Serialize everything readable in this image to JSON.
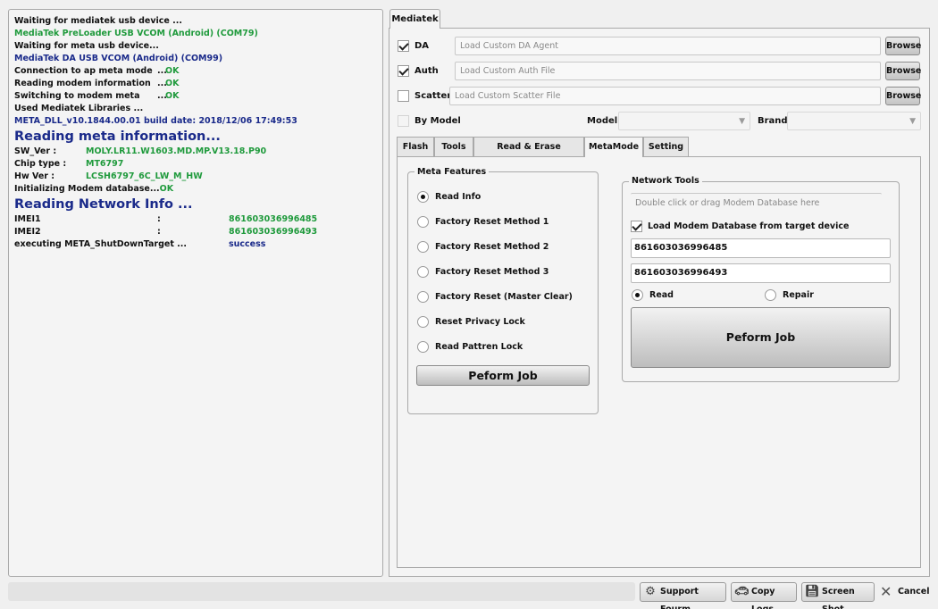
{
  "log": {
    "l1": "Waiting for mediatek usb device ...",
    "l2": "MediaTek PreLoader USB VCOM (Android)  (COM79)",
    "l3": "Waiting for meta usb device...",
    "l4": "MediaTek DA USB VCOM (Android) (COM99)",
    "l5_a": "Connection to ap meta mode",
    "l5_b": "...",
    "l5_c": "OK",
    "l6_a": "Reading modem information",
    "l6_b": "...",
    "l6_c": "OK",
    "l7_a": "Switching to modem meta",
    "l7_b": "...",
    "l7_c": "OK",
    "l8": "Used Mediatek Libraries ...",
    "l9": "META_DLL_v10.1844.00.01 build date: 2018/12/06 17:49:53",
    "h1": "Reading meta information...",
    "sw_label": "SW_Ver :",
    "sw_val": "MOLY.LR11.W1603.MD.MP.V13.18.P90",
    "chip_label": "Chip type :",
    "chip_val": "MT6797",
    "hw_label": "Hw Ver :",
    "hw_val": "LCSH6797_6C_LW_M_HW",
    "init_a": "Initializing Modem database...",
    "init_b": "OK",
    "h2": "Reading Network Info    ...",
    "imei1_label": "IMEI1",
    "imei1_colon": ":",
    "imei1_val": "861603036996485",
    "imei2_label": "IMEI2",
    "imei2_colon": ":",
    "imei2_val": "861603036996493",
    "shut_a": "executing META_ShutDownTarget ...",
    "shut_b": "success"
  },
  "main_tab": "Mediatek",
  "top": {
    "da_label": "DA",
    "da_placeholder": "Load Custom DA Agent",
    "auth_label": "Auth",
    "auth_placeholder": "Load Custom Auth File",
    "scatter_label": "Scatter",
    "scatter_placeholder": "Load Custom Scatter File",
    "browse": "Browse",
    "bymodel_label": "By Model",
    "model_label": "Model",
    "brand_label": "Brand"
  },
  "subtabs": {
    "flash": "Flash",
    "tools": "Tools",
    "read_erase": "Read & Erase Operation",
    "metamode": "MetaMode",
    "setting": "Setting"
  },
  "meta": {
    "title": "Meta Features",
    "options": [
      "Read Info",
      "Factory Reset Method 1",
      "Factory Reset Method 2",
      "Factory Reset Method 3",
      "Factory Reset (Master Clear)",
      "Reset Privacy Lock",
      "Read Pattren Lock"
    ],
    "perform": "Peform Job"
  },
  "network": {
    "title": "Network Tools",
    "db_placeholder": "Double click or drag Modem Database  here",
    "load_label": "Load Modem Database from target device",
    "imei1": "861603036996485",
    "imei2": "861603036996493",
    "read": "Read",
    "repair": "Repair",
    "perform": "Peform Job"
  },
  "bottom": {
    "support": "Support Fourm",
    "copy": "Copy Logs",
    "screenshot": "Screen Shot",
    "cancel": "Cancel"
  },
  "icons": {
    "support": "gear-icon",
    "copy": "car-icon",
    "screenshot": "floppy-disk-icon",
    "cancel": "close-icon"
  }
}
